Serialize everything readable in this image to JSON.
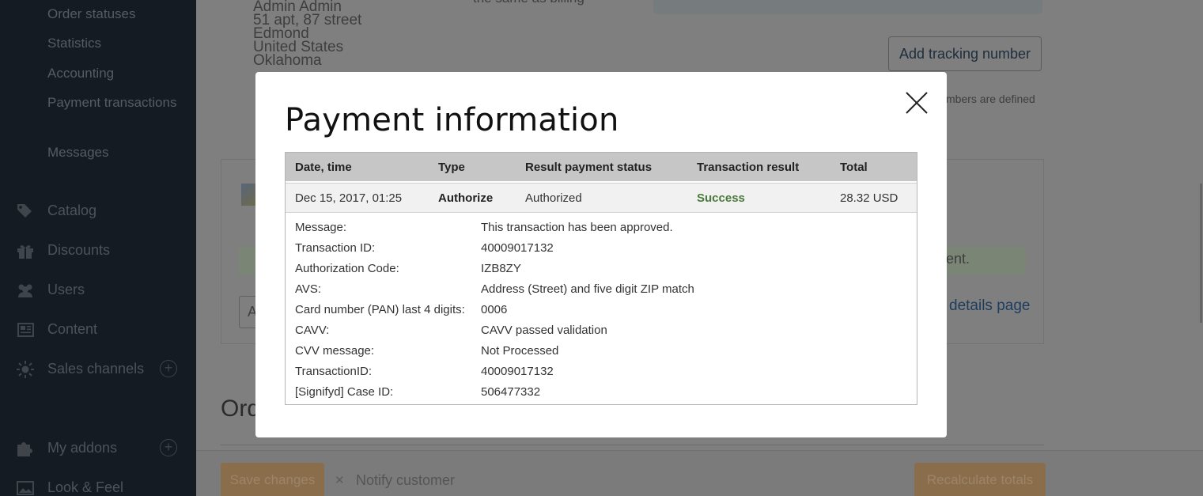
{
  "sidebar": {
    "sub_items": [
      "Order statuses",
      "Statistics",
      "Accounting",
      "Payment transactions",
      "Messages"
    ],
    "nav": [
      {
        "label": "Catalog",
        "icon": "tags-icon"
      },
      {
        "label": "Discounts",
        "icon": "gift-icon"
      },
      {
        "label": "Users",
        "icon": "users-icon"
      },
      {
        "label": "Content",
        "icon": "newspaper-icon"
      },
      {
        "label": "Sales channels",
        "icon": "sun-icon",
        "plus": "+"
      },
      {
        "label": "My addons",
        "icon": "puzzle-icon",
        "plus": "+"
      },
      {
        "label": "Look & Feel",
        "icon": "image-icon"
      }
    ]
  },
  "background": {
    "address_lines": [
      "Admin Admin",
      "51 apt, 87 street",
      "Edmond",
      "United States",
      "Oklahoma"
    ],
    "same_as_billing": "the same as billing",
    "add_tracking_label": "Add tracking number",
    "tracking_note": "mbers are defined",
    "green_note": "ent.",
    "a_box": "A",
    "details_link": "details page",
    "ord_heading": "Ord",
    "save_changes": "Save changes",
    "notify_check": "✕",
    "notify_customer": "Notify customer",
    "recalculate": "Recalculate totals"
  },
  "modal": {
    "title": "Payment information",
    "columns": [
      "Date, time",
      "Type",
      "Result payment status",
      "Transaction result",
      "Total"
    ],
    "row": {
      "date": "Dec 15, 2017, 01:25",
      "type": "Authorize",
      "status": "Authorized",
      "result": "Success",
      "total": "28.32 USD"
    },
    "details": [
      {
        "k": "Message:",
        "v": "This transaction has been approved."
      },
      {
        "k": "Transaction ID:",
        "v": "40009017132"
      },
      {
        "k": "Authorization Code:",
        "v": "IZB8ZY"
      },
      {
        "k": "AVS:",
        "v": "Address (Street) and five digit ZIP match"
      },
      {
        "k": "Card number (PAN) last 4 digits:",
        "v": "0006"
      },
      {
        "k": "CAVV:",
        "v": "CAVV passed validation"
      },
      {
        "k": "CVV message:",
        "v": "Not Processed"
      },
      {
        "k": "TransactionID:",
        "v": "40009017132"
      },
      {
        "k": "[Signifyd] Case ID:",
        "v": "506477332"
      }
    ]
  },
  "colors": {
    "sidebar_bg": "#141b22",
    "overlay": "#7f7f7f",
    "success": "#4a7a3a",
    "table_header": "#c6c6c6"
  }
}
